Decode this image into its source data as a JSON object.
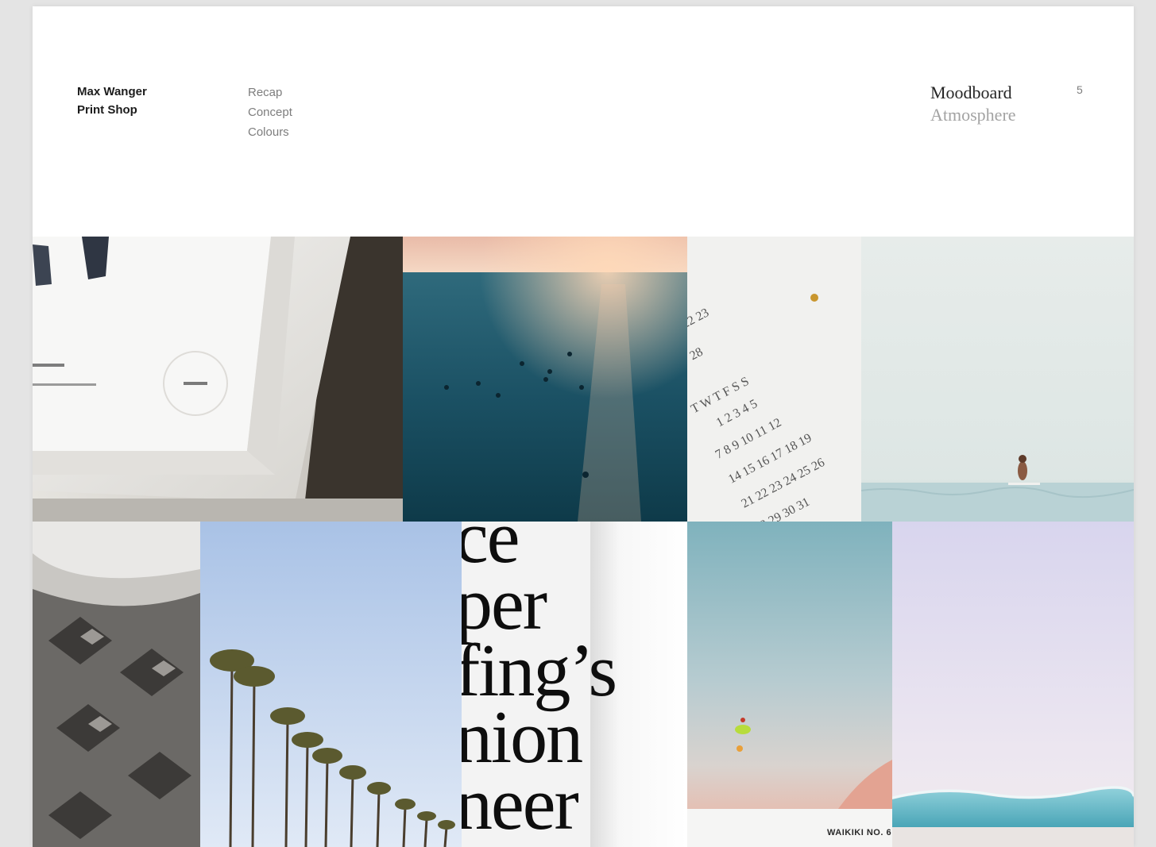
{
  "header": {
    "brand_line1": "Max Wanger",
    "brand_line2": "Print Shop",
    "nav": [
      {
        "label": "Recap"
      },
      {
        "label": "Concept"
      },
      {
        "label": "Colours"
      }
    ],
    "section_title": "Moodboard",
    "section_subtitle": "Atmosphere",
    "page_number": "5"
  },
  "moodboard": {
    "typography_words": [
      "ce",
      "per",
      "fing’s",
      "nion",
      "neer"
    ],
    "aerial_caption": "WAIKIKI NO. 6"
  },
  "colors": {
    "sheet": "#ffffff",
    "backdrop": "#e4e4e4",
    "ocean_deep": "#12414f",
    "sunset_glow": "#f0b7a4",
    "sky_blue": "#b3c9e8",
    "lavender": "#dcd9ee",
    "wave_teal": "#5fb7c6"
  }
}
